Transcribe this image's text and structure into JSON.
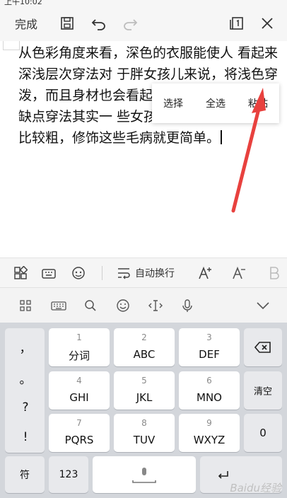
{
  "status": {
    "time": "上午10:02"
  },
  "toolbar": {
    "done_label": "完成"
  },
  "editor": {
    "lines": [
      "从色彩角度来看，深色的衣服能使人 看起来",
      "深浅层次穿法对 于胖女孩儿来说，将浅色穿",
      "泼，而且身材也会看起 色",
      "缺点穿法其实一 些女孩儿总体来说并不胖",
      "比较粗，修饰这些毛病就更简单。"
    ]
  },
  "context_menu": {
    "items": [
      "选择",
      "全选",
      "粘贴"
    ]
  },
  "format_bar": {
    "wrap_label": "自动换行"
  },
  "keyboard": {
    "left_symbols": [
      "，",
      "。",
      "?",
      "!"
    ],
    "keys": [
      {
        "num": "1",
        "label": "分词"
      },
      {
        "num": "2",
        "label": "ABC"
      },
      {
        "num": "3",
        "label": "DEF"
      },
      {
        "num": "4",
        "label": "GHI"
      },
      {
        "num": "5",
        "label": "JKL"
      },
      {
        "num": "6",
        "label": "MNO"
      },
      {
        "num": "7",
        "label": "PQRS"
      },
      {
        "num": "8",
        "label": "TUV"
      },
      {
        "num": "9",
        "label": "WXYZ"
      }
    ],
    "clear_label": "清空",
    "zero_label": "0",
    "fu_label": "符",
    "num123_label": "123"
  },
  "watermark": "Baidu经验",
  "colors": {
    "arrow": "#e8413e",
    "background": "#f6f6f6",
    "keyboard_bg": "#d3d6db"
  }
}
